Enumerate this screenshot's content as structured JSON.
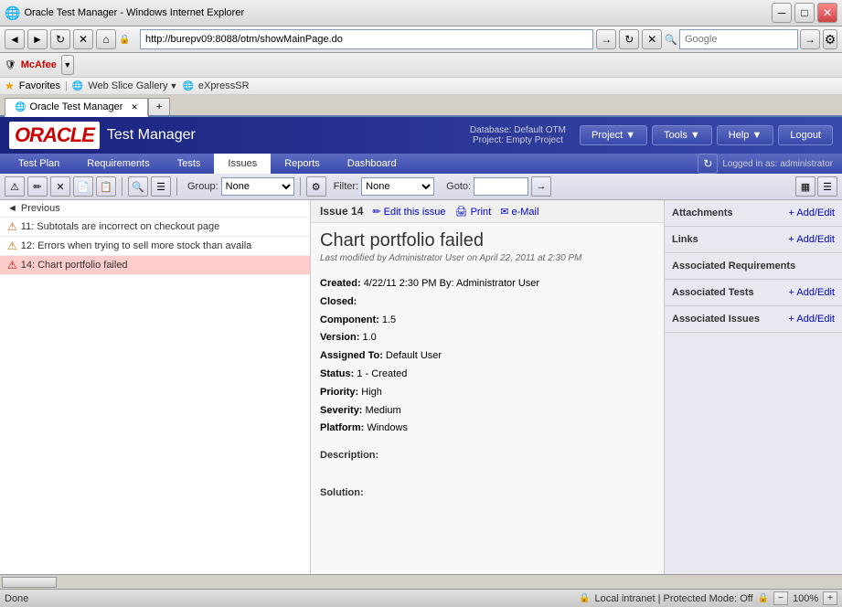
{
  "browser": {
    "title": "Oracle Test Manager - Windows Internet Explorer",
    "address": "http://burepv09:8088/otm/showMainPage.do",
    "search_placeholder": "Google",
    "tabs": [
      {
        "label": "Oracle Test Manager",
        "active": true
      },
      {
        "label": "",
        "active": false
      }
    ],
    "favorites": {
      "label": "Favorites",
      "items": [
        "Web Slice Gallery",
        "eXpressSR"
      ]
    }
  },
  "app": {
    "oracle_logo": "ORACLE",
    "title": "Test Manager",
    "database": "Database: Default OTM",
    "project": "Project: Empty Project",
    "header_buttons": [
      "Project",
      "Tools",
      "Help",
      "Logout"
    ]
  },
  "nav": {
    "tabs": [
      "Test Plan",
      "Requirements",
      "Tests",
      "Issues",
      "Reports",
      "Dashboard"
    ],
    "active_tab": "Issues",
    "logged_in": "Logged in as: administrator"
  },
  "toolbar": {
    "group_label": "Group:",
    "group_value": "None",
    "filter_label": "Filter:",
    "filter_value": "None",
    "goto_label": "Goto:"
  },
  "issue_list": {
    "previous_label": "Previous",
    "items": [
      {
        "id": "11",
        "label": "11: Subtotals are incorrect on checkout page",
        "type": "warning",
        "active": false
      },
      {
        "id": "12",
        "label": "12: Errors when trying to sell more stock than availa",
        "type": "warning",
        "active": false
      },
      {
        "id": "14",
        "label": "14: Chart portfolio failed",
        "type": "error",
        "active": true
      }
    ]
  },
  "issue_detail": {
    "issue_number": "Issue 14",
    "edit_label": "Edit this issue",
    "print_label": "Print",
    "email_label": "e-Mail",
    "title": "Chart portfolio failed",
    "modified": "Last modified by Administrator User on April 22, 2011 at 2:30 PM",
    "fields": {
      "created_label": "Created:",
      "created_value": "4/22/11 2:30 PM By: Administrator User",
      "closed_label": "Closed:",
      "closed_value": "",
      "component_label": "Component:",
      "component_value": "1.5",
      "version_label": "Version:",
      "version_value": "1.0",
      "assigned_label": "Assigned To:",
      "assigned_value": "Default User",
      "status_label": "Status:",
      "status_value": "1 - Created",
      "priority_label": "Priority:",
      "priority_value": "High",
      "severity_label": "Severity:",
      "severity_value": "Medium",
      "platform_label": "Platform:",
      "platform_value": "Windows"
    },
    "description_label": "Description:",
    "solution_label": "Solution:"
  },
  "associations": {
    "attachments": {
      "title": "Attachments",
      "add_label": "+ Add/Edit"
    },
    "links": {
      "title": "Links",
      "add_label": "+ Add/Edit"
    },
    "requirements": {
      "title": "Associated Requirements"
    },
    "tests": {
      "title": "Associated Tests",
      "add_label": "+ Add/Edit"
    },
    "issues": {
      "title": "Associated Issues",
      "add_label": "+ Add/Edit"
    }
  },
  "status": {
    "text": "Done",
    "zone": "Local intranet | Protected Mode: Off",
    "zoom": "100%"
  },
  "icons": {
    "back": "◄",
    "forward": "►",
    "refresh": "↻",
    "stop": "✕",
    "home": "⌂",
    "search": "🔍",
    "star": "★",
    "warning": "⚠",
    "error": "⚠",
    "edit": "✏",
    "printer": "🖨",
    "envelope": "✉",
    "plus": "+",
    "group": "▦",
    "prev": "◄"
  }
}
